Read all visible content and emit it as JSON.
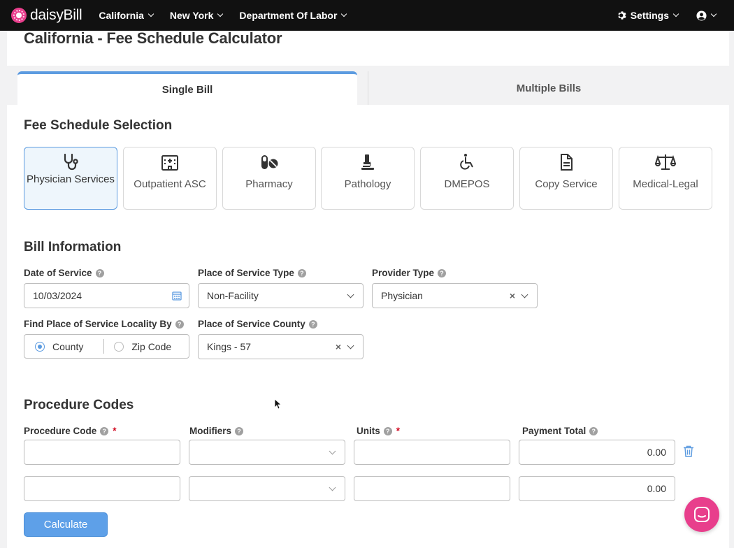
{
  "nav": {
    "brand": "daisyBill",
    "menus": [
      "California",
      "New York",
      "Department Of Labor"
    ],
    "settings_label": "Settings"
  },
  "page": {
    "title": "California - Fee Schedule Calculator"
  },
  "tabs": [
    {
      "label": "Single Bill",
      "active": true
    },
    {
      "label": "Multiple Bills",
      "active": false
    }
  ],
  "fee_schedule": {
    "title": "Fee Schedule Selection",
    "cards": [
      {
        "label": "Physician Services",
        "icon": "stethoscope-icon",
        "selected": true
      },
      {
        "label": "Outpatient ASC",
        "icon": "hospital-icon",
        "selected": false
      },
      {
        "label": "Pharmacy",
        "icon": "pills-icon",
        "selected": false
      },
      {
        "label": "Pathology",
        "icon": "microscope-icon",
        "selected": false
      },
      {
        "label": "DMEPOS",
        "icon": "wheelchair-icon",
        "selected": false
      },
      {
        "label": "Copy Service",
        "icon": "document-icon",
        "selected": false
      },
      {
        "label": "Medical-Legal",
        "icon": "scale-icon",
        "selected": false
      }
    ]
  },
  "bill_info": {
    "title": "Bill Information",
    "date_of_service": {
      "label": "Date of Service",
      "value": "10/03/2024"
    },
    "place_of_service_type": {
      "label": "Place of Service Type",
      "value": "Non-Facility"
    },
    "provider_type": {
      "label": "Provider Type",
      "value": "Physician"
    },
    "locality_by": {
      "label": "Find Place of Service Locality By",
      "options": [
        "County",
        "Zip Code"
      ],
      "selected": "County"
    },
    "county": {
      "label": "Place of Service County",
      "value": "Kings - 57"
    }
  },
  "procedure": {
    "title": "Procedure Codes",
    "columns": [
      "Procedure Code",
      "Modifiers",
      "Units",
      "Payment Total"
    ],
    "rows": [
      {
        "code": "",
        "modifiers": "",
        "units": "",
        "payment_total": "0.00"
      },
      {
        "code": "",
        "modifiers": "",
        "units": "",
        "payment_total": "0.00"
      }
    ],
    "calculate_label": "Calculate"
  },
  "colors": {
    "accent": "#5c9be0",
    "brand": "#e83e8c",
    "nav_bg": "#111111"
  }
}
